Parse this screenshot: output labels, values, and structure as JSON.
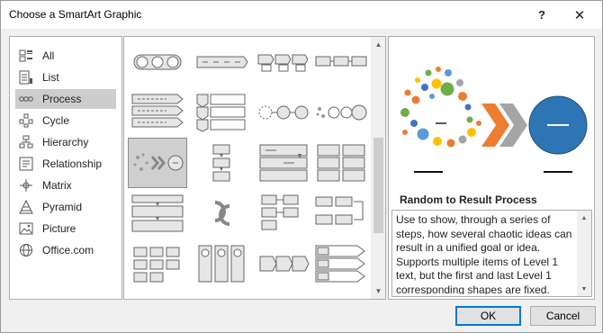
{
  "window": {
    "title": "Choose a SmartArt Graphic",
    "help_glyph": "?",
    "close_glyph": "✕"
  },
  "categories": [
    {
      "label": "All",
      "icon": "all-icon",
      "selected": false
    },
    {
      "label": "List",
      "icon": "list-icon",
      "selected": false
    },
    {
      "label": "Process",
      "icon": "process-icon",
      "selected": true
    },
    {
      "label": "Cycle",
      "icon": "cycle-icon",
      "selected": false
    },
    {
      "label": "Hierarchy",
      "icon": "hierarchy-icon",
      "selected": false
    },
    {
      "label": "Relationship",
      "icon": "relationship-icon",
      "selected": false
    },
    {
      "label": "Matrix",
      "icon": "matrix-icon",
      "selected": false
    },
    {
      "label": "Pyramid",
      "icon": "pyramid-icon",
      "selected": false
    },
    {
      "label": "Picture",
      "icon": "picture-icon",
      "selected": false
    },
    {
      "label": "Office.com",
      "icon": "office-com-icon",
      "selected": false
    }
  ],
  "gallery": {
    "selected_layout": "Random to Result Process",
    "scroll_up_glyph": "▲",
    "scroll_down_glyph": "▼"
  },
  "preview": {
    "title": "Random to Result Process",
    "description": "Use to show, through a series of steps, how several chaotic  ideas can result in a unified goal or idea. Supports multiple items of Level 1 text, but the first and last Level 1 corresponding shapes are fixed. Works best with small amounts of",
    "placeholder_dash": "—",
    "colors": {
      "accent_blue": "#2e75b6",
      "chevron_orange": "#ed7d31",
      "chevron_gray": "#a5a5a5"
    }
  },
  "buttons": {
    "ok": "OK",
    "cancel": "Cancel"
  }
}
